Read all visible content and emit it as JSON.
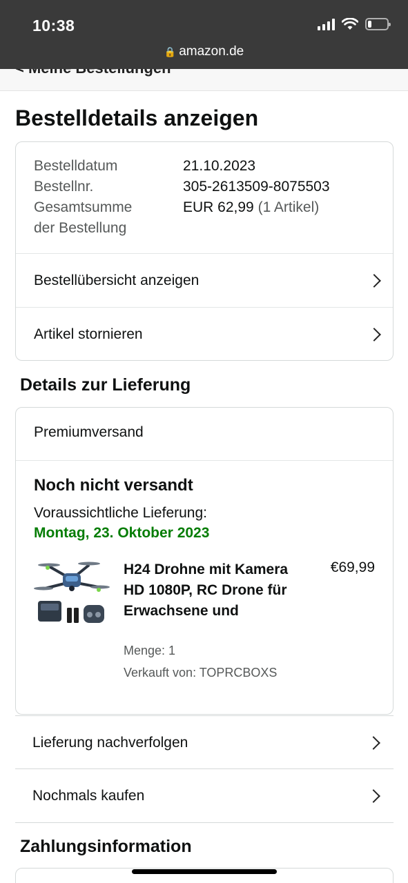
{
  "status_bar": {
    "time": "10:38"
  },
  "browser": {
    "url": "amazon.de"
  },
  "back_link": "< Meine Bestellungen",
  "page_title": "Bestelldetails anzeigen",
  "order_summary": {
    "order_date_label": "Bestelldatum",
    "order_date": "21.10.2023",
    "order_number_label": "Bestellnr.",
    "order_number": "305-2613509-8075503",
    "total_label_line1": "Gesamtsumme",
    "total_label_line2": "der Bestellung",
    "total_value": "EUR 62,99",
    "total_items": "(1 Artikel)",
    "links": [
      {
        "label": "Bestellübersicht anzeigen"
      },
      {
        "label": "Artikel stornieren"
      }
    ]
  },
  "delivery": {
    "section_title": "Details zur Lieferung",
    "shipping_method": "Premiumversand",
    "status": "Noch nicht versandt",
    "eta_label": "Voraussichtliche Lieferung:",
    "eta_date": "Montag, 23. Oktober 2023",
    "eta_color": "#067d06",
    "item": {
      "title": "H24 Drohne mit Kamera HD 1080P, RC Drone für Erwachsene und",
      "price": "€69,99",
      "quantity": "Menge: 1",
      "seller": "Verkauft von: TOPRCBOXS"
    },
    "actions": [
      {
        "label": "Lieferung nachverfolgen"
      },
      {
        "label": "Nochmals kaufen"
      }
    ]
  },
  "payment": {
    "section_title": "Zahlungsinformation"
  }
}
